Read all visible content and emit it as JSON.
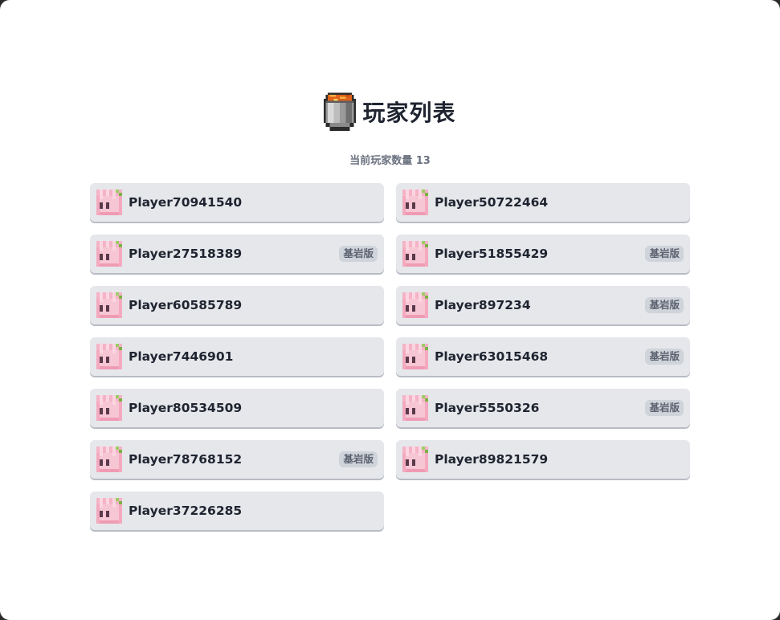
{
  "title": "玩家列表",
  "header_icon": "lava-bucket-icon",
  "player_count_text": "当前玩家数量 13",
  "badge_label": "基岩版",
  "colors": {
    "card_bg": "#e5e7eb",
    "badge_bg": "#cfd3da",
    "title_text": "#1f2430",
    "muted_text": "#6b7280"
  },
  "players": [
    {
      "name": "Player70941540",
      "bedrock": false
    },
    {
      "name": "Player50722464",
      "bedrock": false
    },
    {
      "name": "Player27518389",
      "bedrock": true
    },
    {
      "name": "Player51855429",
      "bedrock": true
    },
    {
      "name": "Player60585789",
      "bedrock": false
    },
    {
      "name": "Player897234",
      "bedrock": true
    },
    {
      "name": "Player7446901",
      "bedrock": false
    },
    {
      "name": "Player63015468",
      "bedrock": true
    },
    {
      "name": "Player80534509",
      "bedrock": false
    },
    {
      "name": "Player5550326",
      "bedrock": true
    },
    {
      "name": "Player78768152",
      "bedrock": true
    },
    {
      "name": "Player89821579",
      "bedrock": false
    },
    {
      "name": "Player37226285",
      "bedrock": false
    }
  ]
}
